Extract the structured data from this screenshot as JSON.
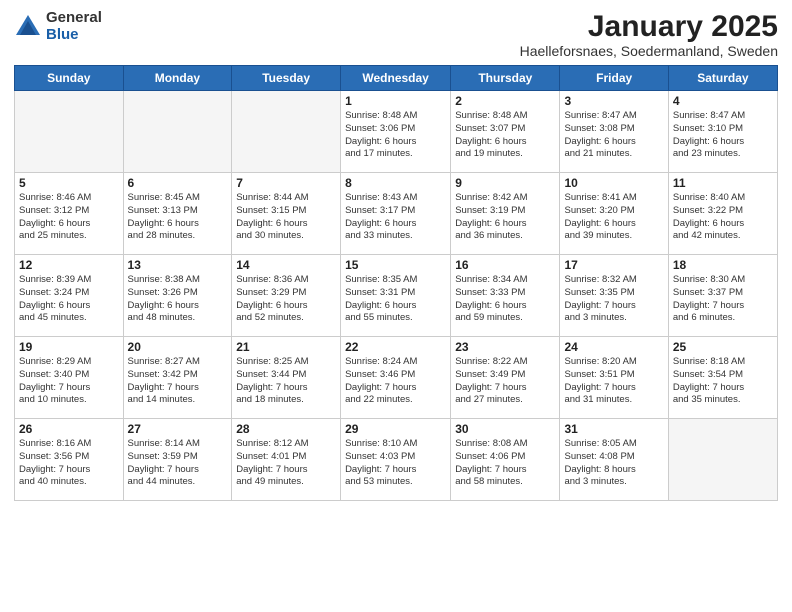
{
  "logo": {
    "general": "General",
    "blue": "Blue"
  },
  "title": {
    "month": "January 2025",
    "location": "Haelleforsnaes, Soedermanland, Sweden"
  },
  "weekdays": [
    "Sunday",
    "Monday",
    "Tuesday",
    "Wednesday",
    "Thursday",
    "Friday",
    "Saturday"
  ],
  "weeks": [
    [
      {
        "day": "",
        "info": ""
      },
      {
        "day": "",
        "info": ""
      },
      {
        "day": "",
        "info": ""
      },
      {
        "day": "1",
        "info": "Sunrise: 8:48 AM\nSunset: 3:06 PM\nDaylight: 6 hours\nand 17 minutes."
      },
      {
        "day": "2",
        "info": "Sunrise: 8:48 AM\nSunset: 3:07 PM\nDaylight: 6 hours\nand 19 minutes."
      },
      {
        "day": "3",
        "info": "Sunrise: 8:47 AM\nSunset: 3:08 PM\nDaylight: 6 hours\nand 21 minutes."
      },
      {
        "day": "4",
        "info": "Sunrise: 8:47 AM\nSunset: 3:10 PM\nDaylight: 6 hours\nand 23 minutes."
      }
    ],
    [
      {
        "day": "5",
        "info": "Sunrise: 8:46 AM\nSunset: 3:12 PM\nDaylight: 6 hours\nand 25 minutes."
      },
      {
        "day": "6",
        "info": "Sunrise: 8:45 AM\nSunset: 3:13 PM\nDaylight: 6 hours\nand 28 minutes."
      },
      {
        "day": "7",
        "info": "Sunrise: 8:44 AM\nSunset: 3:15 PM\nDaylight: 6 hours\nand 30 minutes."
      },
      {
        "day": "8",
        "info": "Sunrise: 8:43 AM\nSunset: 3:17 PM\nDaylight: 6 hours\nand 33 minutes."
      },
      {
        "day": "9",
        "info": "Sunrise: 8:42 AM\nSunset: 3:19 PM\nDaylight: 6 hours\nand 36 minutes."
      },
      {
        "day": "10",
        "info": "Sunrise: 8:41 AM\nSunset: 3:20 PM\nDaylight: 6 hours\nand 39 minutes."
      },
      {
        "day": "11",
        "info": "Sunrise: 8:40 AM\nSunset: 3:22 PM\nDaylight: 6 hours\nand 42 minutes."
      }
    ],
    [
      {
        "day": "12",
        "info": "Sunrise: 8:39 AM\nSunset: 3:24 PM\nDaylight: 6 hours\nand 45 minutes."
      },
      {
        "day": "13",
        "info": "Sunrise: 8:38 AM\nSunset: 3:26 PM\nDaylight: 6 hours\nand 48 minutes."
      },
      {
        "day": "14",
        "info": "Sunrise: 8:36 AM\nSunset: 3:29 PM\nDaylight: 6 hours\nand 52 minutes."
      },
      {
        "day": "15",
        "info": "Sunrise: 8:35 AM\nSunset: 3:31 PM\nDaylight: 6 hours\nand 55 minutes."
      },
      {
        "day": "16",
        "info": "Sunrise: 8:34 AM\nSunset: 3:33 PM\nDaylight: 6 hours\nand 59 minutes."
      },
      {
        "day": "17",
        "info": "Sunrise: 8:32 AM\nSunset: 3:35 PM\nDaylight: 7 hours\nand 3 minutes."
      },
      {
        "day": "18",
        "info": "Sunrise: 8:30 AM\nSunset: 3:37 PM\nDaylight: 7 hours\nand 6 minutes."
      }
    ],
    [
      {
        "day": "19",
        "info": "Sunrise: 8:29 AM\nSunset: 3:40 PM\nDaylight: 7 hours\nand 10 minutes."
      },
      {
        "day": "20",
        "info": "Sunrise: 8:27 AM\nSunset: 3:42 PM\nDaylight: 7 hours\nand 14 minutes."
      },
      {
        "day": "21",
        "info": "Sunrise: 8:25 AM\nSunset: 3:44 PM\nDaylight: 7 hours\nand 18 minutes."
      },
      {
        "day": "22",
        "info": "Sunrise: 8:24 AM\nSunset: 3:46 PM\nDaylight: 7 hours\nand 22 minutes."
      },
      {
        "day": "23",
        "info": "Sunrise: 8:22 AM\nSunset: 3:49 PM\nDaylight: 7 hours\nand 27 minutes."
      },
      {
        "day": "24",
        "info": "Sunrise: 8:20 AM\nSunset: 3:51 PM\nDaylight: 7 hours\nand 31 minutes."
      },
      {
        "day": "25",
        "info": "Sunrise: 8:18 AM\nSunset: 3:54 PM\nDaylight: 7 hours\nand 35 minutes."
      }
    ],
    [
      {
        "day": "26",
        "info": "Sunrise: 8:16 AM\nSunset: 3:56 PM\nDaylight: 7 hours\nand 40 minutes."
      },
      {
        "day": "27",
        "info": "Sunrise: 8:14 AM\nSunset: 3:59 PM\nDaylight: 7 hours\nand 44 minutes."
      },
      {
        "day": "28",
        "info": "Sunrise: 8:12 AM\nSunset: 4:01 PM\nDaylight: 7 hours\nand 49 minutes."
      },
      {
        "day": "29",
        "info": "Sunrise: 8:10 AM\nSunset: 4:03 PM\nDaylight: 7 hours\nand 53 minutes."
      },
      {
        "day": "30",
        "info": "Sunrise: 8:08 AM\nSunset: 4:06 PM\nDaylight: 7 hours\nand 58 minutes."
      },
      {
        "day": "31",
        "info": "Sunrise: 8:05 AM\nSunset: 4:08 PM\nDaylight: 8 hours\nand 3 minutes."
      },
      {
        "day": "",
        "info": ""
      }
    ]
  ]
}
